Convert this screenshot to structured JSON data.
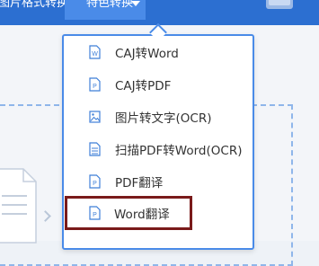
{
  "nav": {
    "tabs": [
      {
        "label": "图片格式转换"
      },
      {
        "label": "特色转换"
      }
    ]
  },
  "icons": {
    "caret": "chevron-down-icon",
    "user": "user-avatar-icon",
    "word_doc": "word-doc-icon",
    "pdf_doc": "pdf-doc-icon",
    "image": "image-icon",
    "scan_doc": "scan-doc-icon"
  },
  "colors": {
    "topbar": "#2c6fd1",
    "active_tab": "#4a8be8",
    "dropdown_border": "#4a8be8",
    "highlight_box": "#7a1a1a",
    "icon_blue": "#3f7fd8"
  },
  "dropdown": {
    "items": [
      {
        "label": "CAJ转Word",
        "icon": "word-doc-icon"
      },
      {
        "label": "CAJ转PDF",
        "icon": "pdf-doc-icon"
      },
      {
        "label": "图片转文字(OCR)",
        "icon": "image-icon"
      },
      {
        "label": "扫描PDF转Word(OCR)",
        "icon": "scan-doc-icon"
      },
      {
        "label": "PDF翻译",
        "icon": "pdf-doc-icon"
      },
      {
        "label": "Word翻译",
        "icon": "pdf-doc-icon",
        "highlighted": true
      }
    ]
  }
}
